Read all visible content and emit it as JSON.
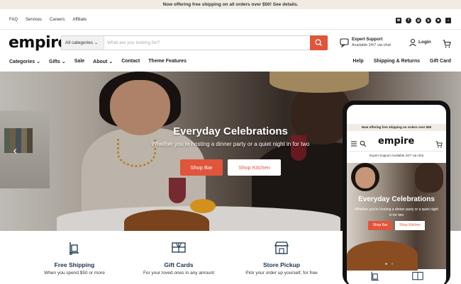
{
  "announcement": "Now offering free shipping on all orders over $50! See details.",
  "utility_links": [
    "FAQ",
    "Services",
    "Careers",
    "Affiliate"
  ],
  "social_icons": [
    "email-icon",
    "facebook-icon",
    "instagram-icon",
    "pinterest-icon",
    "snapchat-icon",
    "tiktok-icon"
  ],
  "brand": {
    "logo": "empire",
    "accent": "#e0553b",
    "navy": "#1b3550"
  },
  "search": {
    "category": "All categories",
    "placeholder": "What are you looking for?"
  },
  "support": {
    "title": "Expert Support",
    "subtitle": "Available 24/7 via chat"
  },
  "account": {
    "login": "Login"
  },
  "nav_left": [
    "Categories",
    "Gifts",
    "Sale",
    "About",
    "Contact",
    "Theme Features"
  ],
  "nav_right": [
    "Help",
    "Shipping & Returns",
    "Gift Card"
  ],
  "hero": {
    "title": "Everyday Celebrations",
    "subtitle": "Whether you're hosting a dinner party or a quiet night in for two",
    "primary_button": "Shop Bar",
    "secondary_button": "Shop Kitchen"
  },
  "features": [
    {
      "title": "Free Shipping",
      "desc": "When you spend $50 or more",
      "icon": "dolly-icon"
    },
    {
      "title": "Gift Cards",
      "desc": "For your loved ones in any amount",
      "icon": "gift-card-icon"
    },
    {
      "title": "Store Pickup",
      "desc": "Pick your order up yourself, for free",
      "icon": "storefront-icon"
    }
  ],
  "mobile": {
    "announcement": "Now offering free shipping on orders over $50",
    "logo": "empire",
    "support": "Expert Support  Available 24/7 via chat",
    "title": "Everyday Celebrations",
    "subtitle": "Whether you're hosting a dinner party or a quiet night in for two",
    "primary_button": "Shop Bar",
    "secondary_button": "Shop Kitchen"
  }
}
